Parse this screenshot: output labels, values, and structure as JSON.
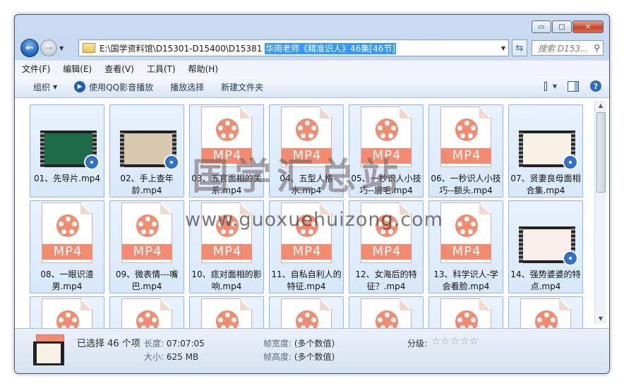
{
  "window": {
    "controls": {
      "minimize": "▭",
      "maximize": "□",
      "close": "✕"
    }
  },
  "address": {
    "path_prefix": "E:\\国学资料馆\\D15301-D15400\\D15381 ",
    "path_selected": "华雨老师《精准识人》46集[46节]",
    "search_placeholder": "搜索 D153..."
  },
  "menu": [
    "文件(F)",
    "编辑(E)",
    "查看(V)",
    "工具(T)",
    "帮助(H)"
  ],
  "toolbar": {
    "organize": "组织",
    "play_qq": "使用QQ影音播放",
    "play_select": "播放选择",
    "new_folder": "新建文件夹"
  },
  "files": [
    {
      "name": "01、先导片.mp4",
      "type": "video",
      "screen": "#1e6b4a"
    },
    {
      "name": "02、手上查年龄.mp4",
      "type": "video",
      "screen": "#d9c8b0"
    },
    {
      "name": "03、五官面相的关系.mp4",
      "type": "mp4"
    },
    {
      "name": "04、五型人格水.mp4",
      "type": "mp4"
    },
    {
      "name": "05、一秒识人小技巧--眉毛.mp4",
      "type": "mp4"
    },
    {
      "name": "06、一秒识人小技巧--额头.mp4",
      "type": "mp4"
    },
    {
      "name": "07、贤妻良母面相合集.mp4",
      "type": "video",
      "screen": "#f7f1e6"
    },
    {
      "name": "08、一眼识渣男.mp4",
      "type": "mp4"
    },
    {
      "name": "09、微表情---嘴巴.mp4",
      "type": "mp4"
    },
    {
      "name": "10、痣对面相的影响.mp4",
      "type": "mp4"
    },
    {
      "name": "11、自私自利人的特征.mp4",
      "type": "mp4"
    },
    {
      "name": "12、女海后的特征？.mp4",
      "type": "mp4"
    },
    {
      "name": "13、科学识人-学会看脸.mp4",
      "type": "mp4"
    },
    {
      "name": "14、强势婆婆的特点.mp4",
      "type": "video",
      "screen": "#f7eeea"
    },
    {
      "name": "",
      "type": "mp4"
    },
    {
      "name": "",
      "type": "mp4"
    },
    {
      "name": "",
      "type": "mp4"
    },
    {
      "name": "",
      "type": "mp4"
    },
    {
      "name": "",
      "type": "mp4"
    },
    {
      "name": "",
      "type": "mp4"
    },
    {
      "name": "",
      "type": "mp4"
    }
  ],
  "mp4_label": "MP4",
  "watermark": {
    "cn": "国学汇总站",
    "url": "www.guoxuehuizong.com"
  },
  "details": {
    "selected": "已选择 46 个项",
    "length_key": "长度:",
    "length_val": "07:07:05",
    "size_key": "大小:",
    "size_val": "625 MB",
    "fw_key": "帧宽度:",
    "fw_val": "(多个数值)",
    "fh_key": "帧高度:",
    "fh_val": "(多个数值)",
    "rating_key": "分级:",
    "rating_stars": "☆☆☆☆☆"
  },
  "colors": {
    "accent": "#3399ff",
    "mp4": "#f28b6f"
  }
}
